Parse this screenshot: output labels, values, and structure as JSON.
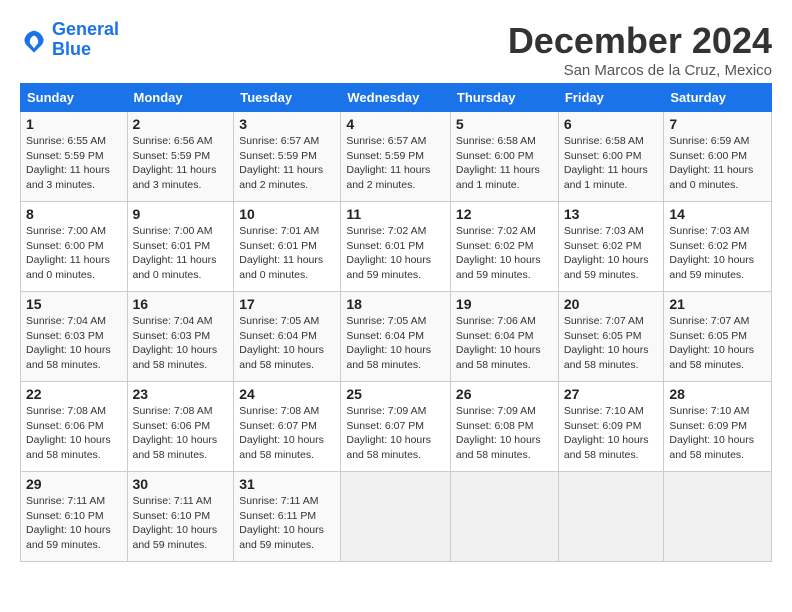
{
  "header": {
    "logo_line1": "General",
    "logo_line2": "Blue",
    "month_title": "December 2024",
    "location": "San Marcos de la Cruz, Mexico"
  },
  "weekdays": [
    "Sunday",
    "Monday",
    "Tuesday",
    "Wednesday",
    "Thursday",
    "Friday",
    "Saturday"
  ],
  "weeks": [
    [
      {
        "day": "1",
        "info": "Sunrise: 6:55 AM\nSunset: 5:59 PM\nDaylight: 11 hours\nand 3 minutes."
      },
      {
        "day": "2",
        "info": "Sunrise: 6:56 AM\nSunset: 5:59 PM\nDaylight: 11 hours\nand 3 minutes."
      },
      {
        "day": "3",
        "info": "Sunrise: 6:57 AM\nSunset: 5:59 PM\nDaylight: 11 hours\nand 2 minutes."
      },
      {
        "day": "4",
        "info": "Sunrise: 6:57 AM\nSunset: 5:59 PM\nDaylight: 11 hours\nand 2 minutes."
      },
      {
        "day": "5",
        "info": "Sunrise: 6:58 AM\nSunset: 6:00 PM\nDaylight: 11 hours\nand 1 minute."
      },
      {
        "day": "6",
        "info": "Sunrise: 6:58 AM\nSunset: 6:00 PM\nDaylight: 11 hours\nand 1 minute."
      },
      {
        "day": "7",
        "info": "Sunrise: 6:59 AM\nSunset: 6:00 PM\nDaylight: 11 hours\nand 0 minutes."
      }
    ],
    [
      {
        "day": "8",
        "info": "Sunrise: 7:00 AM\nSunset: 6:00 PM\nDaylight: 11 hours\nand 0 minutes."
      },
      {
        "day": "9",
        "info": "Sunrise: 7:00 AM\nSunset: 6:01 PM\nDaylight: 11 hours\nand 0 minutes."
      },
      {
        "day": "10",
        "info": "Sunrise: 7:01 AM\nSunset: 6:01 PM\nDaylight: 11 hours\nand 0 minutes."
      },
      {
        "day": "11",
        "info": "Sunrise: 7:02 AM\nSunset: 6:01 PM\nDaylight: 10 hours\nand 59 minutes."
      },
      {
        "day": "12",
        "info": "Sunrise: 7:02 AM\nSunset: 6:02 PM\nDaylight: 10 hours\nand 59 minutes."
      },
      {
        "day": "13",
        "info": "Sunrise: 7:03 AM\nSunset: 6:02 PM\nDaylight: 10 hours\nand 59 minutes."
      },
      {
        "day": "14",
        "info": "Sunrise: 7:03 AM\nSunset: 6:02 PM\nDaylight: 10 hours\nand 59 minutes."
      }
    ],
    [
      {
        "day": "15",
        "info": "Sunrise: 7:04 AM\nSunset: 6:03 PM\nDaylight: 10 hours\nand 58 minutes."
      },
      {
        "day": "16",
        "info": "Sunrise: 7:04 AM\nSunset: 6:03 PM\nDaylight: 10 hours\nand 58 minutes."
      },
      {
        "day": "17",
        "info": "Sunrise: 7:05 AM\nSunset: 6:04 PM\nDaylight: 10 hours\nand 58 minutes."
      },
      {
        "day": "18",
        "info": "Sunrise: 7:05 AM\nSunset: 6:04 PM\nDaylight: 10 hours\nand 58 minutes."
      },
      {
        "day": "19",
        "info": "Sunrise: 7:06 AM\nSunset: 6:04 PM\nDaylight: 10 hours\nand 58 minutes."
      },
      {
        "day": "20",
        "info": "Sunrise: 7:07 AM\nSunset: 6:05 PM\nDaylight: 10 hours\nand 58 minutes."
      },
      {
        "day": "21",
        "info": "Sunrise: 7:07 AM\nSunset: 6:05 PM\nDaylight: 10 hours\nand 58 minutes."
      }
    ],
    [
      {
        "day": "22",
        "info": "Sunrise: 7:08 AM\nSunset: 6:06 PM\nDaylight: 10 hours\nand 58 minutes."
      },
      {
        "day": "23",
        "info": "Sunrise: 7:08 AM\nSunset: 6:06 PM\nDaylight: 10 hours\nand 58 minutes."
      },
      {
        "day": "24",
        "info": "Sunrise: 7:08 AM\nSunset: 6:07 PM\nDaylight: 10 hours\nand 58 minutes."
      },
      {
        "day": "25",
        "info": "Sunrise: 7:09 AM\nSunset: 6:07 PM\nDaylight: 10 hours\nand 58 minutes."
      },
      {
        "day": "26",
        "info": "Sunrise: 7:09 AM\nSunset: 6:08 PM\nDaylight: 10 hours\nand 58 minutes."
      },
      {
        "day": "27",
        "info": "Sunrise: 7:10 AM\nSunset: 6:09 PM\nDaylight: 10 hours\nand 58 minutes."
      },
      {
        "day": "28",
        "info": "Sunrise: 7:10 AM\nSunset: 6:09 PM\nDaylight: 10 hours\nand 58 minutes."
      }
    ],
    [
      {
        "day": "29",
        "info": "Sunrise: 7:11 AM\nSunset: 6:10 PM\nDaylight: 10 hours\nand 59 minutes."
      },
      {
        "day": "30",
        "info": "Sunrise: 7:11 AM\nSunset: 6:10 PM\nDaylight: 10 hours\nand 59 minutes."
      },
      {
        "day": "31",
        "info": "Sunrise: 7:11 AM\nSunset: 6:11 PM\nDaylight: 10 hours\nand 59 minutes."
      },
      null,
      null,
      null,
      null
    ]
  ]
}
